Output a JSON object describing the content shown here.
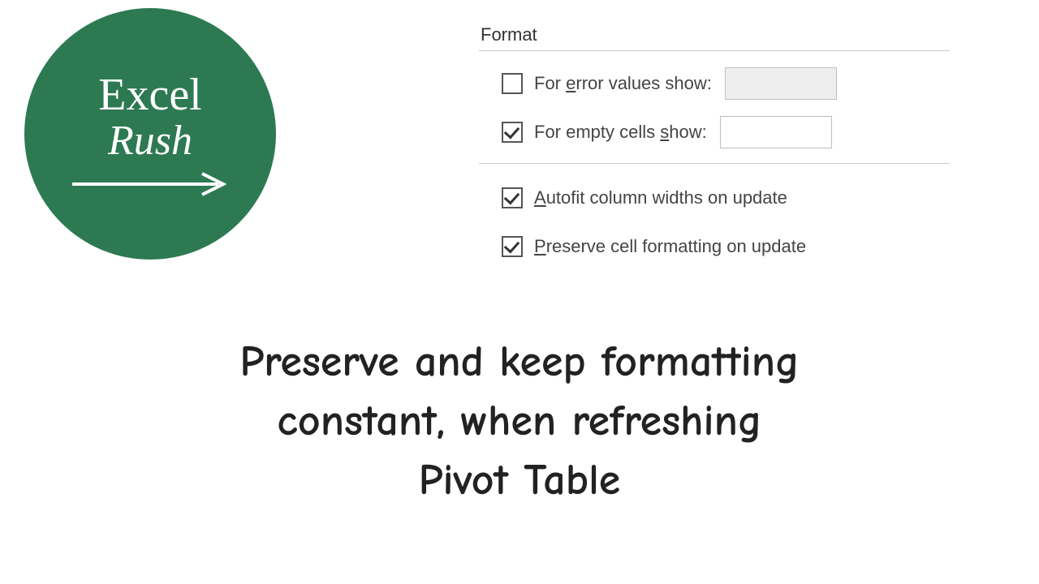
{
  "logo": {
    "line1": "Excel",
    "line2": "Rush"
  },
  "dialog": {
    "section_title": "Format",
    "options": {
      "error_values": {
        "checked": false,
        "label_pre": "For ",
        "label_underline": "e",
        "label_post": "rror values show:",
        "value": "",
        "input_disabled": true
      },
      "empty_cells": {
        "checked": true,
        "label_pre": "For empty cells ",
        "label_underline": "s",
        "label_post": "how:",
        "value": "",
        "input_disabled": false
      },
      "autofit": {
        "checked": true,
        "label_underline": "A",
        "label_post": "utofit column widths on update"
      },
      "preserve": {
        "checked": true,
        "label_underline": "P",
        "label_post": "reserve cell formatting on update"
      }
    }
  },
  "caption": {
    "line1": "Preserve and keep formatting",
    "line2": "constant, when refreshing",
    "line3": "Pivot Table"
  }
}
